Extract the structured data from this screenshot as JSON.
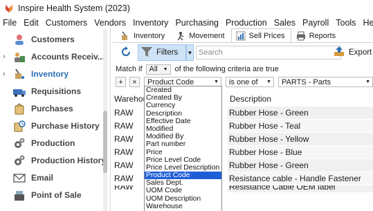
{
  "app": {
    "title": "Inspire Health System (2023)"
  },
  "menu": [
    "File",
    "Edit",
    "Customers",
    "Vendors",
    "Inventory",
    "Purchasing",
    "Production",
    "Sales",
    "Payroll",
    "Tools",
    "Help"
  ],
  "sidebar": {
    "items": [
      {
        "label": "Customers",
        "icon": "customers-icon",
        "chevron": ""
      },
      {
        "label": "Accounts Receiv...",
        "icon": "accounts-receivable-icon",
        "chevron": "›"
      },
      {
        "label": "Inventory",
        "icon": "inventory-icon",
        "chevron": "›",
        "active": true
      },
      {
        "label": "Requisitions",
        "icon": "requisitions-icon",
        "chevron": ""
      },
      {
        "label": "Purchases",
        "icon": "purchases-icon",
        "chevron": ""
      },
      {
        "label": "Purchase History",
        "icon": "purchase-history-icon",
        "chevron": ""
      },
      {
        "label": "Production",
        "icon": "production-icon",
        "chevron": ""
      },
      {
        "label": "Production History",
        "icon": "production-history-icon",
        "chevron": ""
      },
      {
        "label": "Email",
        "icon": "email-icon",
        "chevron": ""
      },
      {
        "label": "Point of Sale",
        "icon": "point-of-sale-icon",
        "chevron": ""
      }
    ]
  },
  "tabs": [
    {
      "label": "Inventory",
      "icon": "inventory-tab-icon"
    },
    {
      "label": "Movement",
      "icon": "movement-tab-icon"
    },
    {
      "label": "Sell Prices",
      "icon": "sell-prices-tab-icon",
      "active": true
    },
    {
      "label": "Reports",
      "icon": "reports-tab-icon"
    }
  ],
  "toolbar": {
    "filters_label": "Filters",
    "search_placeholder": "Search",
    "export_label": "Export"
  },
  "match": {
    "prefix": "Match if",
    "value": "All",
    "suffix": "of the following criteria are true"
  },
  "criteria": {
    "add": "+",
    "remove": "×",
    "field": "Product Code",
    "operator": "is one of",
    "value": "PARTS - Parts"
  },
  "grid": {
    "headers": [
      "Warehou",
      "Description"
    ],
    "rows": [
      {
        "warehouse": "RAW",
        "description": "Rubber Hose - Green"
      },
      {
        "warehouse": "RAW",
        "description": "Rubber Hose - Teal"
      },
      {
        "warehouse": "RAW",
        "description": "Rubber Hose - Yellow"
      },
      {
        "warehouse": "RAW",
        "description": "Rubber Hose - Blue"
      },
      {
        "warehouse": "RAW",
        "description": "Rubber Hose - Green"
      },
      {
        "warehouse": "RAW",
        "description": "Resistance cable - Handle Fastener"
      },
      {
        "warehouse": "RAW",
        "description": "Resistance Cable OEM label"
      }
    ]
  },
  "field_options": {
    "items": [
      "Created",
      "Created By",
      "Currency",
      "Description",
      "Effective Date",
      "Modified",
      "Modified By",
      "Part number",
      "Price",
      "Price Level Code",
      "Price Level Description",
      "Product Code",
      "Sales Dept.",
      "UOM Code",
      "UOM Description",
      "Warehouse"
    ],
    "selected": "Product Code"
  },
  "colors": {
    "accent": "#1f5fd6",
    "active_nav": "#2d6fb3",
    "filters_bg": "#cfe3f7"
  }
}
